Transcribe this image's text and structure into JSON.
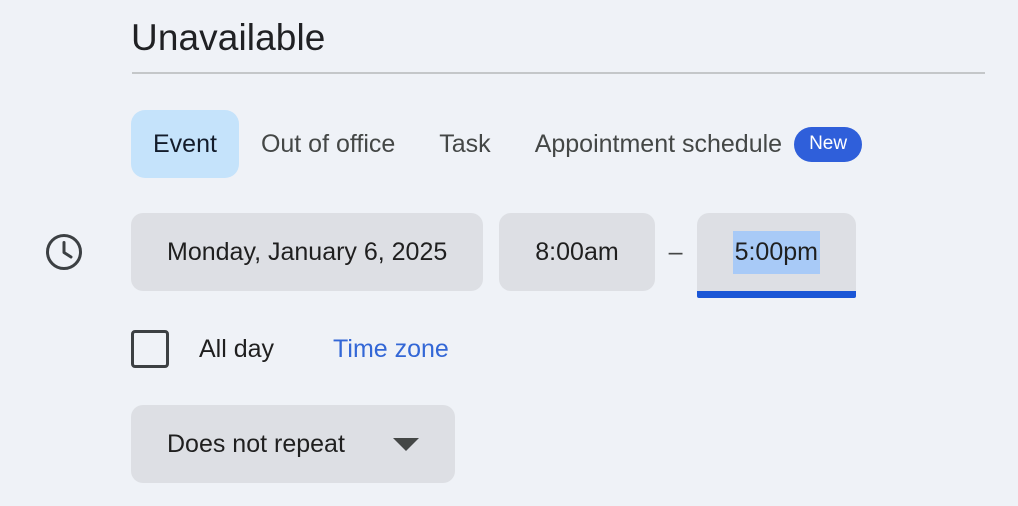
{
  "header": {
    "title": "Unavailable"
  },
  "tabs": [
    {
      "label": "Event",
      "selected": true
    },
    {
      "label": "Out of office",
      "selected": false
    },
    {
      "label": "Task",
      "selected": false
    },
    {
      "label": "Appointment schedule",
      "selected": false,
      "badge": "New"
    }
  ],
  "schedule": {
    "icon": "clock-icon",
    "date": "Monday, January 6, 2025",
    "start_time": "8:00am",
    "separator": "–",
    "end_time": "5:00pm",
    "end_time_focused": true,
    "all_day_label": "All day",
    "all_day_checked": false,
    "time_zone_link": "Time zone",
    "repeat": "Does not repeat"
  },
  "colors": {
    "background": "#eff2f7",
    "chip": "#dddfe4",
    "tab_selected_bg": "#c5e3fb",
    "badge_blue": "#2f5fda",
    "link_blue": "#3367d6",
    "focus_underline": "#1a56d6",
    "text_selection": "#a8caf7"
  }
}
